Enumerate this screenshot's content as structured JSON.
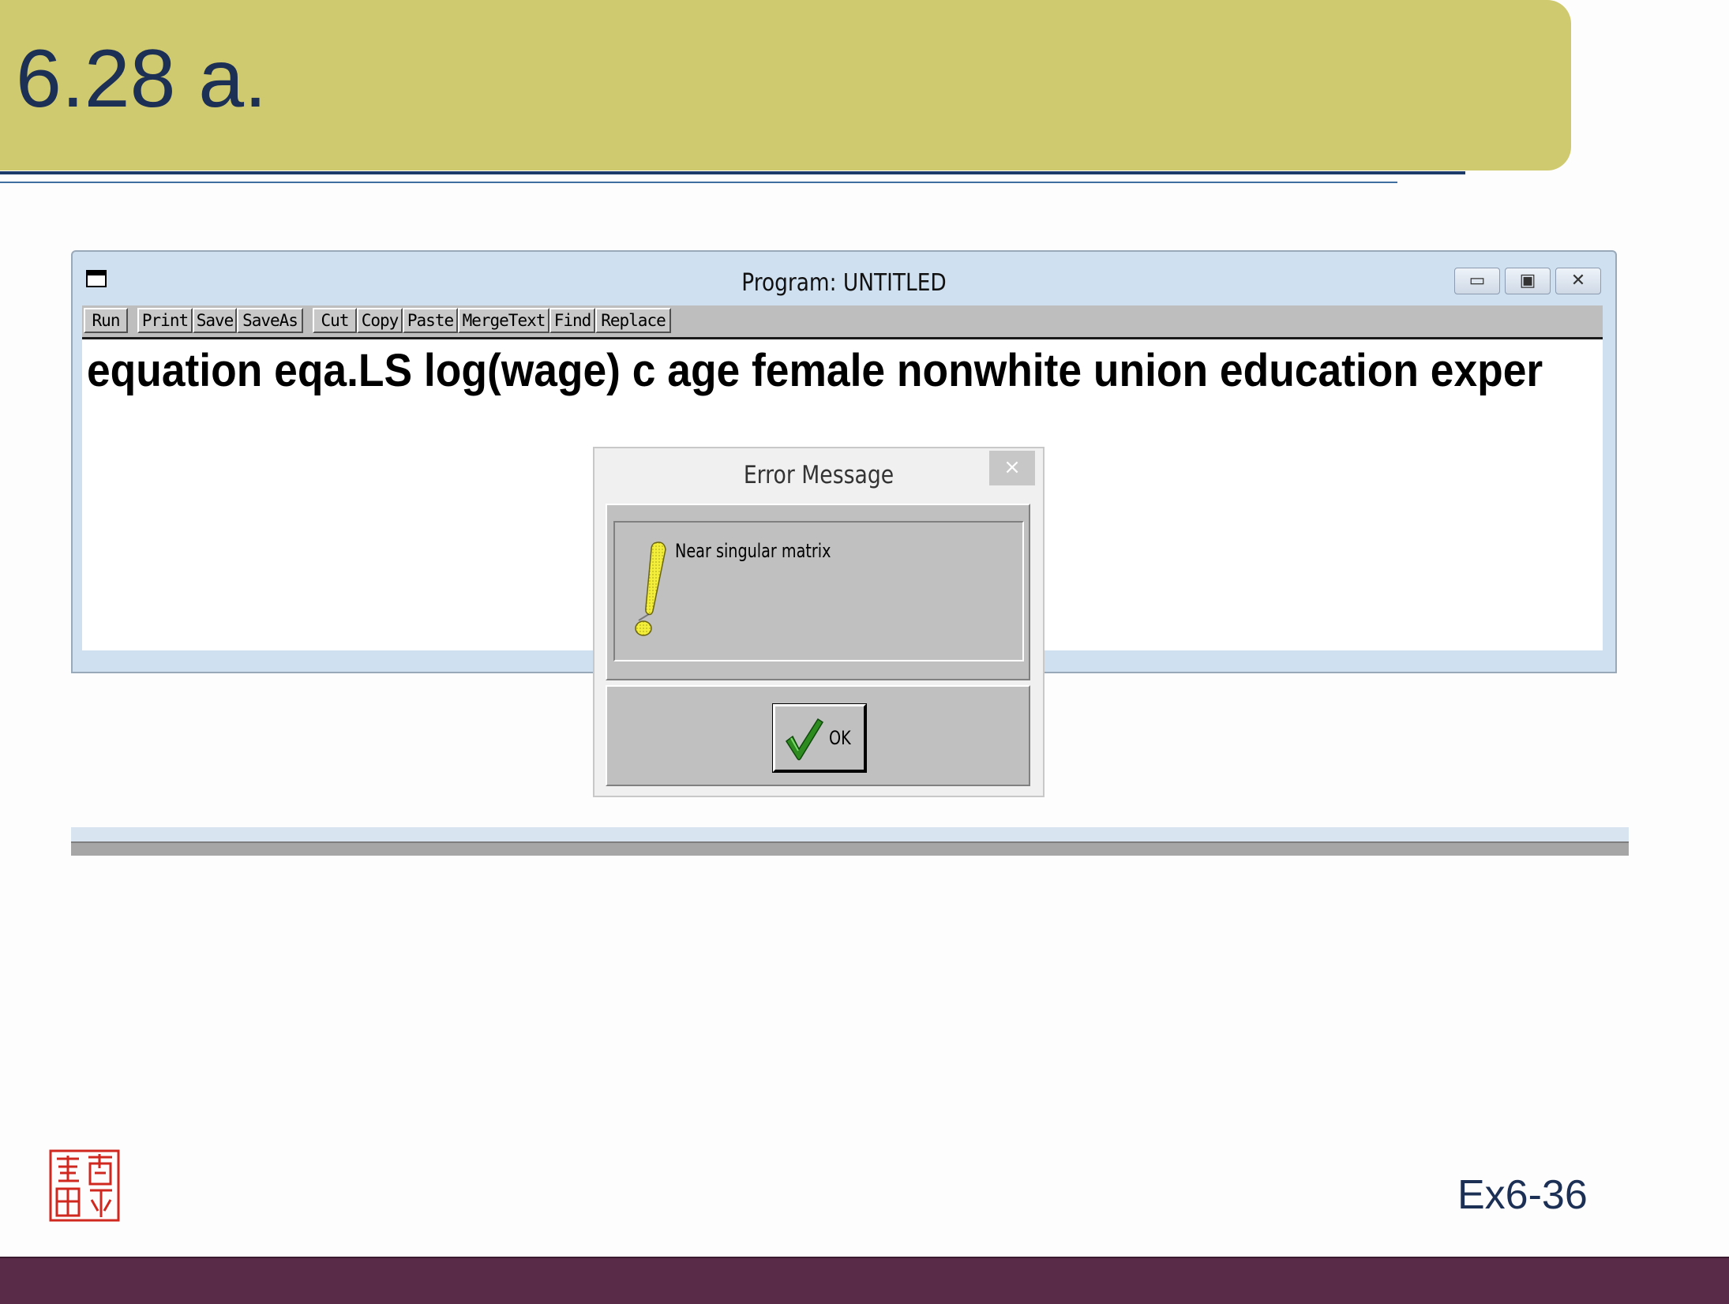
{
  "slide": {
    "title": "6.28 a.",
    "number": "Ex6-36",
    "colors": {
      "header": "#cfca6f",
      "title_text": "#1c2f55",
      "footer": "#5a2b48"
    }
  },
  "program_window": {
    "title": "Program: UNTITLED",
    "controls": {
      "minimize": "▭",
      "maximize": "▣",
      "close": "✕"
    },
    "toolbar": {
      "run": "Run",
      "print": "Print",
      "save": "Save",
      "save_as": "SaveAs",
      "cut": "Cut",
      "copy": "Copy",
      "paste": "Paste",
      "merge_text": "MergeText",
      "find": "Find",
      "replace": "Replace"
    },
    "editor_text": "equation eqa.LS log(wage) c age female nonwhite union education exper"
  },
  "error_dialog": {
    "title": "Error Message",
    "close": "×",
    "message": "Near singular matrix",
    "icon": "exclamation-icon",
    "ok_label": "OK"
  }
}
